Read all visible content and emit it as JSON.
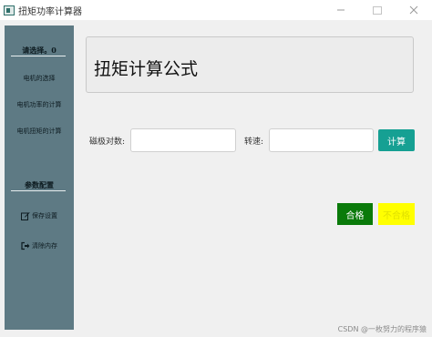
{
  "window": {
    "title": "扭矩功率计算器",
    "icon": "app-window-icon",
    "controls": [
      "minimize-icon",
      "maximize-icon",
      "close-icon"
    ]
  },
  "sidebar": {
    "section1_title": "请选择。0",
    "items": [
      {
        "label": "电机的选择"
      },
      {
        "label": "电机功率的计算"
      },
      {
        "label": "电机扭矩的计算"
      }
    ],
    "section2_title": "参数配置",
    "actions": [
      {
        "label": "保存设置",
        "icon": "edit-icon"
      },
      {
        "label": "清除内存",
        "icon": "sign-out-icon"
      }
    ],
    "background_color": "#5e7a84"
  },
  "main": {
    "formula_title": "扭矩计算公式",
    "pole_pairs_label": "磁极对数:",
    "pole_pairs_value": "",
    "speed_label": "转速:",
    "speed_value": "",
    "calc_button": "计算",
    "pass_button": "合格",
    "fail_button": "不合格"
  },
  "colors": {
    "calc_button": "#16a093",
    "pass_button": "#0a7a0a",
    "fail_button": "#ffff00"
  },
  "watermark": "CSDN @一枚努力的程序猿"
}
